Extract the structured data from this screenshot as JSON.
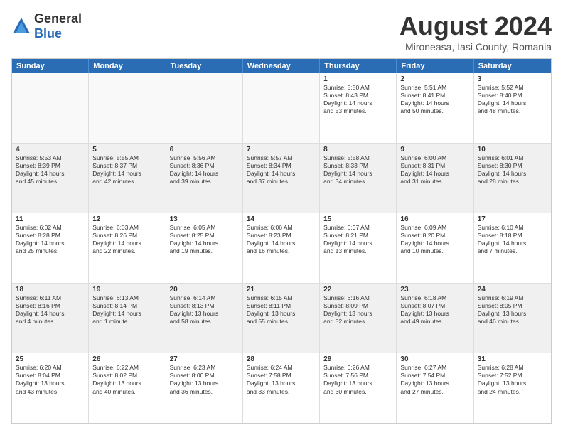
{
  "header": {
    "logo_general": "General",
    "logo_blue": "Blue",
    "month_title": "August 2024",
    "location": "Mironeasa, Iasi County, Romania"
  },
  "weekdays": [
    "Sunday",
    "Monday",
    "Tuesday",
    "Wednesday",
    "Thursday",
    "Friday",
    "Saturday"
  ],
  "rows": [
    {
      "cells": [
        {
          "day": "",
          "text": "",
          "empty": true
        },
        {
          "day": "",
          "text": "",
          "empty": true
        },
        {
          "day": "",
          "text": "",
          "empty": true
        },
        {
          "day": "",
          "text": "",
          "empty": true
        },
        {
          "day": "1",
          "text": "Sunrise: 5:50 AM\nSunset: 8:43 PM\nDaylight: 14 hours\nand 53 minutes.",
          "empty": false
        },
        {
          "day": "2",
          "text": "Sunrise: 5:51 AM\nSunset: 8:41 PM\nDaylight: 14 hours\nand 50 minutes.",
          "empty": false
        },
        {
          "day": "3",
          "text": "Sunrise: 5:52 AM\nSunset: 8:40 PM\nDaylight: 14 hours\nand 48 minutes.",
          "empty": false
        }
      ],
      "shaded": false
    },
    {
      "cells": [
        {
          "day": "4",
          "text": "Sunrise: 5:53 AM\nSunset: 8:39 PM\nDaylight: 14 hours\nand 45 minutes.",
          "empty": false
        },
        {
          "day": "5",
          "text": "Sunrise: 5:55 AM\nSunset: 8:37 PM\nDaylight: 14 hours\nand 42 minutes.",
          "empty": false
        },
        {
          "day": "6",
          "text": "Sunrise: 5:56 AM\nSunset: 8:36 PM\nDaylight: 14 hours\nand 39 minutes.",
          "empty": false
        },
        {
          "day": "7",
          "text": "Sunrise: 5:57 AM\nSunset: 8:34 PM\nDaylight: 14 hours\nand 37 minutes.",
          "empty": false
        },
        {
          "day": "8",
          "text": "Sunrise: 5:58 AM\nSunset: 8:33 PM\nDaylight: 14 hours\nand 34 minutes.",
          "empty": false
        },
        {
          "day": "9",
          "text": "Sunrise: 6:00 AM\nSunset: 8:31 PM\nDaylight: 14 hours\nand 31 minutes.",
          "empty": false
        },
        {
          "day": "10",
          "text": "Sunrise: 6:01 AM\nSunset: 8:30 PM\nDaylight: 14 hours\nand 28 minutes.",
          "empty": false
        }
      ],
      "shaded": true
    },
    {
      "cells": [
        {
          "day": "11",
          "text": "Sunrise: 6:02 AM\nSunset: 8:28 PM\nDaylight: 14 hours\nand 25 minutes.",
          "empty": false
        },
        {
          "day": "12",
          "text": "Sunrise: 6:03 AM\nSunset: 8:26 PM\nDaylight: 14 hours\nand 22 minutes.",
          "empty": false
        },
        {
          "day": "13",
          "text": "Sunrise: 6:05 AM\nSunset: 8:25 PM\nDaylight: 14 hours\nand 19 minutes.",
          "empty": false
        },
        {
          "day": "14",
          "text": "Sunrise: 6:06 AM\nSunset: 8:23 PM\nDaylight: 14 hours\nand 16 minutes.",
          "empty": false
        },
        {
          "day": "15",
          "text": "Sunrise: 6:07 AM\nSunset: 8:21 PM\nDaylight: 14 hours\nand 13 minutes.",
          "empty": false
        },
        {
          "day": "16",
          "text": "Sunrise: 6:09 AM\nSunset: 8:20 PM\nDaylight: 14 hours\nand 10 minutes.",
          "empty": false
        },
        {
          "day": "17",
          "text": "Sunrise: 6:10 AM\nSunset: 8:18 PM\nDaylight: 14 hours\nand 7 minutes.",
          "empty": false
        }
      ],
      "shaded": false
    },
    {
      "cells": [
        {
          "day": "18",
          "text": "Sunrise: 6:11 AM\nSunset: 8:16 PM\nDaylight: 14 hours\nand 4 minutes.",
          "empty": false
        },
        {
          "day": "19",
          "text": "Sunrise: 6:13 AM\nSunset: 8:14 PM\nDaylight: 14 hours\nand 1 minute.",
          "empty": false
        },
        {
          "day": "20",
          "text": "Sunrise: 6:14 AM\nSunset: 8:13 PM\nDaylight: 13 hours\nand 58 minutes.",
          "empty": false
        },
        {
          "day": "21",
          "text": "Sunrise: 6:15 AM\nSunset: 8:11 PM\nDaylight: 13 hours\nand 55 minutes.",
          "empty": false
        },
        {
          "day": "22",
          "text": "Sunrise: 6:16 AM\nSunset: 8:09 PM\nDaylight: 13 hours\nand 52 minutes.",
          "empty": false
        },
        {
          "day": "23",
          "text": "Sunrise: 6:18 AM\nSunset: 8:07 PM\nDaylight: 13 hours\nand 49 minutes.",
          "empty": false
        },
        {
          "day": "24",
          "text": "Sunrise: 6:19 AM\nSunset: 8:05 PM\nDaylight: 13 hours\nand 46 minutes.",
          "empty": false
        }
      ],
      "shaded": true
    },
    {
      "cells": [
        {
          "day": "25",
          "text": "Sunrise: 6:20 AM\nSunset: 8:04 PM\nDaylight: 13 hours\nand 43 minutes.",
          "empty": false
        },
        {
          "day": "26",
          "text": "Sunrise: 6:22 AM\nSunset: 8:02 PM\nDaylight: 13 hours\nand 40 minutes.",
          "empty": false
        },
        {
          "day": "27",
          "text": "Sunrise: 6:23 AM\nSunset: 8:00 PM\nDaylight: 13 hours\nand 36 minutes.",
          "empty": false
        },
        {
          "day": "28",
          "text": "Sunrise: 6:24 AM\nSunset: 7:58 PM\nDaylight: 13 hours\nand 33 minutes.",
          "empty": false
        },
        {
          "day": "29",
          "text": "Sunrise: 6:26 AM\nSunset: 7:56 PM\nDaylight: 13 hours\nand 30 minutes.",
          "empty": false
        },
        {
          "day": "30",
          "text": "Sunrise: 6:27 AM\nSunset: 7:54 PM\nDaylight: 13 hours\nand 27 minutes.",
          "empty": false
        },
        {
          "day": "31",
          "text": "Sunrise: 6:28 AM\nSunset: 7:52 PM\nDaylight: 13 hours\nand 24 minutes.",
          "empty": false
        }
      ],
      "shaded": false
    }
  ]
}
